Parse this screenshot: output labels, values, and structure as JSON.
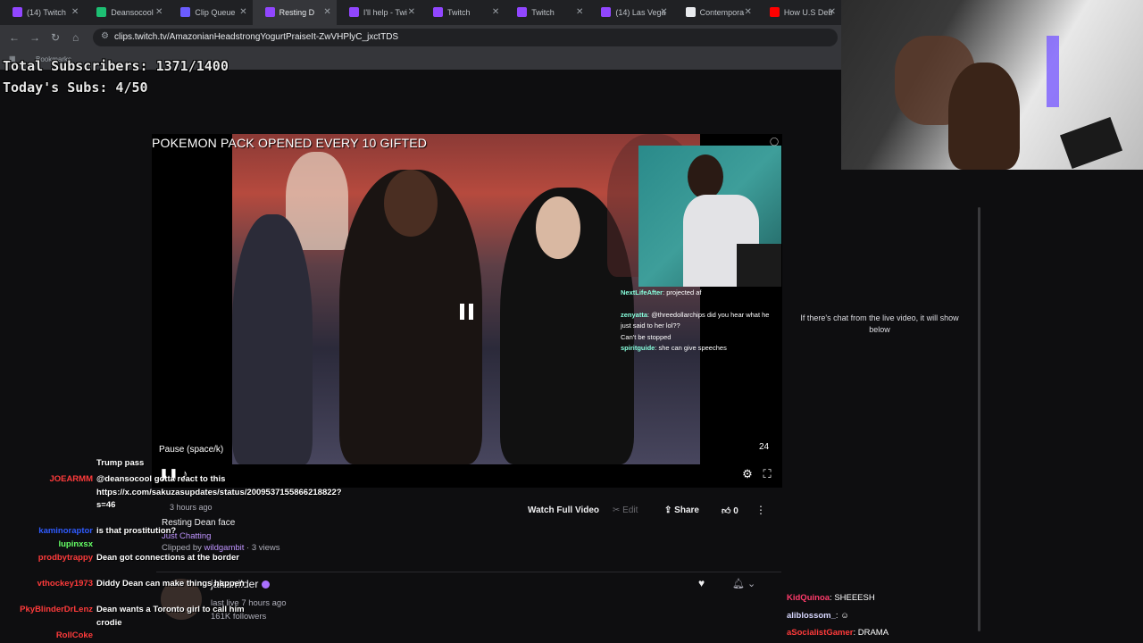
{
  "tabs": [
    {
      "label": "(14) Twitch",
      "color": "#9146ff"
    },
    {
      "label": "Deansocool",
      "color": "#1dbf73"
    },
    {
      "label": "Clip Queue",
      "color": "#6b5cff"
    },
    {
      "label": "Resting D",
      "color": "#9146ff",
      "active": true
    },
    {
      "label": "I'll help - Twi",
      "color": "#9146ff"
    },
    {
      "label": "Twitch",
      "color": "#9146ff"
    },
    {
      "label": "Twitch",
      "color": "#9146ff"
    },
    {
      "label": "(14) Las Vega",
      "color": "#9146ff"
    },
    {
      "label": "Contempora",
      "color": "#e8eaed"
    },
    {
      "label": "How U.S Deb",
      "color": "#ff0000"
    }
  ],
  "address": {
    "url": "clips.twitch.tv/AmazonianHeadstrongYogurtPraiseIt-ZwVHPlyC_jxctTDS"
  },
  "bookmarks": {
    "label": "Bookmarks"
  },
  "stream_overlay": {
    "total_subs": "Total Subscribers: 1371/1400",
    "today_subs": "Today's Subs: 4/50"
  },
  "video": {
    "banner": "POKEMON PACK OPENED EVERY 10 GIFTED",
    "tooltip": "Pause (space/k)",
    "count": "24",
    "chat_overlay": [
      {
        "name": "NextLifeAfter",
        "msg": "projected af"
      },
      {
        "name": "zenyatta",
        "msg": "@threedollarchips did you hear what he just said to her lol??"
      },
      {
        "name": "",
        "msg": "Can't be stopped"
      },
      {
        "name": "spiritguide",
        "msg": "she can give speeches"
      }
    ]
  },
  "clip": {
    "ago": "3 hours ago",
    "title": "Resting Dean face",
    "category": "Just Chatting",
    "clipped_by_prefix": "Clipped by",
    "clipper": "wildgambit",
    "views": " · 3 views",
    "watch_full": "Watch Full Video",
    "edit": "Edit",
    "share": "Share",
    "likes": "0"
  },
  "channel": {
    "name": "jakewilder",
    "last_live": "last live 7 hours ago",
    "followers": "161K followers"
  },
  "overlay_chat": [
    {
      "user": "",
      "msg": "Trump pass",
      "ucolor": "#ffffff"
    },
    {
      "user": "JOEARMM",
      "msg": "@deansocool gotta react to this https://x.com/sakuzasupdates/status/2009537155866218822?s=46",
      "ucolor": "#ff3b3b"
    },
    {
      "user": "kaminoraptor",
      "msg": "is that prostitution?",
      "ucolor": "#2f5bff"
    },
    {
      "user": "lupinxsx",
      "msg": "",
      "ucolor": "#66ff66"
    },
    {
      "user": "prodbytrappy",
      "msg": "Dean got connections at the border",
      "ucolor": "#ff3b3b"
    },
    {
      "user": "vthockey1973",
      "msg": "Diddy Dean can make things happen",
      "ucolor": "#ff3b3b"
    },
    {
      "user": "PkyBlinderDrLenz",
      "msg": "Dean wants a Toronto girl to call him crodie",
      "ucolor": "#ff3b3b"
    },
    {
      "user": "RollCoke",
      "msg": "",
      "ucolor": "#ff3b3b"
    }
  ],
  "right_panel": {
    "info": "If there's chat from the live video, it will show below",
    "chat": [
      {
        "user": "KidQuinoa",
        "msg": "SHEEESH",
        "ucolor": "#ff3b6b"
      },
      {
        "user": "aliblossom_",
        "msg": "",
        "ucolor": "#d8d8ff"
      },
      {
        "user": "aSocialistGamer",
        "msg": "DRAMA",
        "ucolor": "#ff3b3b"
      }
    ]
  },
  "colors": {
    "accent": "#9146ff",
    "link": "#bf94ff",
    "bg": "#0e0e10"
  }
}
